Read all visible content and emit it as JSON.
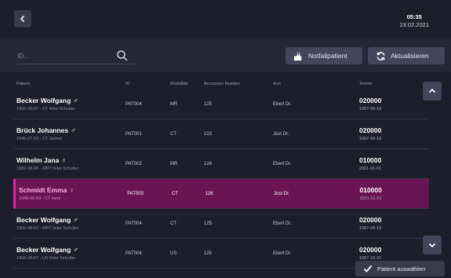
{
  "clock": {
    "time": "05:35",
    "date": "23.02.2021"
  },
  "search": {
    "placeholder": "ID..."
  },
  "buttons": {
    "notfall": "Notfallpatient",
    "aktualisieren": "Aktualisieren",
    "auswaehlen": "Patient auswählen"
  },
  "columns": {
    "patient": "Patient",
    "id": "ID",
    "modality": "Modalität",
    "accession": "Accession Number",
    "arzt": "Arzt",
    "termin": "Termin"
  },
  "rows": [
    {
      "name": "Becker Wolfgang",
      "gender": "♂",
      "detail": "1956-08-07 - CT linke Schulter",
      "id": "PAT004",
      "modality": "MR",
      "accession": "125",
      "arzt": "Ebert Dr.",
      "code": "020000",
      "date": "1997-09-18",
      "selected": false
    },
    {
      "name": "Brück Johannes",
      "gender": "♂",
      "detail": "1945-07-03 - CT Gehirn",
      "id": "PAT001",
      "modality": "CT",
      "accession": "123",
      "arzt": "Jost Dr.",
      "code": "020000",
      "date": "1997-09-18",
      "selected": false
    },
    {
      "name": "Wilhelm Jana",
      "gender": "♀",
      "detail": "1982-08-06 - MRT linke Schulter",
      "id": "PAT002",
      "modality": "MR",
      "accession": "124",
      "arzt": "Ebert Dr.",
      "code": "010000",
      "date": "2001-01-01",
      "selected": false
    },
    {
      "name": "Schmidt Emma",
      "gender": "♀",
      "detail": "1948-06-03 - CT Herz",
      "id": "PAT003",
      "modality": "CT",
      "accession": "126",
      "arzt": "Jost Dr.",
      "code": "010000",
      "date": "2001-01-01",
      "selected": true
    },
    {
      "name": "Becker Wolfgang",
      "gender": "♂",
      "detail": "1956-08-07 - MRT linke Schulter",
      "id": "PAT004",
      "modality": "CT",
      "accession": "125",
      "arzt": "Ebert Dr.",
      "code": "020000",
      "date": "1997-09-18",
      "selected": false
    },
    {
      "name": "Becker Wolfgang",
      "gender": "♂",
      "detail": "1956-08-07 - US linke Schulter",
      "id": "PAT004",
      "modality": "US",
      "accession": "125",
      "arzt": "Ebert Dr.",
      "code": "020000",
      "date": "1997-10-20",
      "selected": false
    }
  ],
  "icons": {
    "back": "chevron-left-icon",
    "search": "search-icon",
    "notfall": "add-patient-icon",
    "refresh": "refresh-icon",
    "up": "chevron-up-icon",
    "down": "chevron-down-icon",
    "check": "check-icon"
  },
  "colors": {
    "selected_bg": "#6a1453",
    "selected_accent": "#e02a9f"
  }
}
